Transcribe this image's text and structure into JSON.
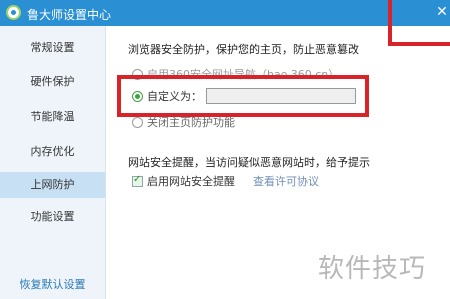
{
  "window": {
    "title": "鲁大师设置中心",
    "close_glyph": "✕"
  },
  "sidebar": {
    "items": [
      {
        "label": "常规设置"
      },
      {
        "label": "硬件保护"
      },
      {
        "label": "节能降温"
      },
      {
        "label": "内存优化"
      },
      {
        "label": "上网防护",
        "active": true
      },
      {
        "label": "功能设置"
      }
    ],
    "footer_label": "恢复默认设置"
  },
  "browser_protection": {
    "heading": "浏览器安全防护，保护您的主页，防止恶意篡改",
    "option_360": "启用360安全网址导航（hao.360.cn）",
    "option_custom": "自定义为：",
    "custom_value": "",
    "option_off": "关闭主页防护功能"
  },
  "site_alert": {
    "heading": "网站安全提醒，当访问疑似恶意网站时，给予提示",
    "enable_label": "启用网站安全提醒",
    "license_link": "查看许可协议"
  },
  "watermark": "软件技巧",
  "colors": {
    "titlebar": "#2a8fd3",
    "highlight": "#d8232a",
    "active_item": "#c8e0f4",
    "footer_link": "#2a7ab8"
  }
}
